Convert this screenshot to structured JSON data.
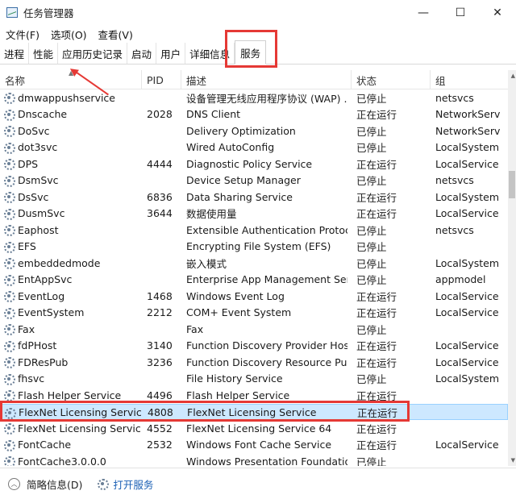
{
  "window": {
    "title": "任务管理器",
    "controls": {
      "minimize": "—",
      "maximize": "☐",
      "close": "✕"
    }
  },
  "menu": [
    {
      "label": "文件(F)"
    },
    {
      "label": "选项(O)"
    },
    {
      "label": "查看(V)"
    }
  ],
  "tabs": [
    {
      "label": "进程"
    },
    {
      "label": "性能"
    },
    {
      "label": "应用历史记录"
    },
    {
      "label": "启动"
    },
    {
      "label": "用户"
    },
    {
      "label": "详细信息"
    },
    {
      "label": "服务",
      "active": true
    }
  ],
  "columns": {
    "name": "名称",
    "pid": "PID",
    "desc": "描述",
    "status": "状态",
    "group": "组"
  },
  "rows": [
    {
      "name": "dmwappushservice",
      "pid": "",
      "desc": "设备管理无线应用程序协议 (WAP) ...",
      "status": "已停止",
      "group": "netsvcs"
    },
    {
      "name": "Dnscache",
      "pid": "2028",
      "desc": "DNS Client",
      "status": "正在运行",
      "group": "NetworkServ..."
    },
    {
      "name": "DoSvc",
      "pid": "",
      "desc": "Delivery Optimization",
      "status": "已停止",
      "group": "NetworkServ..."
    },
    {
      "name": "dot3svc",
      "pid": "",
      "desc": "Wired AutoConfig",
      "status": "已停止",
      "group": "LocalSystem..."
    },
    {
      "name": "DPS",
      "pid": "4444",
      "desc": "Diagnostic Policy Service",
      "status": "正在运行",
      "group": "LocalService..."
    },
    {
      "name": "DsmSvc",
      "pid": "",
      "desc": "Device Setup Manager",
      "status": "已停止",
      "group": "netsvcs"
    },
    {
      "name": "DsSvc",
      "pid": "6836",
      "desc": "Data Sharing Service",
      "status": "正在运行",
      "group": "LocalSystem..."
    },
    {
      "name": "DusmSvc",
      "pid": "3644",
      "desc": "数据使用量",
      "status": "正在运行",
      "group": "LocalService..."
    },
    {
      "name": "Eaphost",
      "pid": "",
      "desc": "Extensible Authentication Protocol",
      "status": "已停止",
      "group": "netsvcs"
    },
    {
      "name": "EFS",
      "pid": "",
      "desc": "Encrypting File System (EFS)",
      "status": "已停止",
      "group": ""
    },
    {
      "name": "embeddedmode",
      "pid": "",
      "desc": "嵌入模式",
      "status": "已停止",
      "group": "LocalSystem..."
    },
    {
      "name": "EntAppSvc",
      "pid": "",
      "desc": "Enterprise App Management Ser...",
      "status": "已停止",
      "group": "appmodel"
    },
    {
      "name": "EventLog",
      "pid": "1468",
      "desc": "Windows Event Log",
      "status": "正在运行",
      "group": "LocalService..."
    },
    {
      "name": "EventSystem",
      "pid": "2212",
      "desc": "COM+ Event System",
      "status": "正在运行",
      "group": "LocalService"
    },
    {
      "name": "Fax",
      "pid": "",
      "desc": "Fax",
      "status": "已停止",
      "group": ""
    },
    {
      "name": "fdPHost",
      "pid": "3140",
      "desc": "Function Discovery Provider Host",
      "status": "正在运行",
      "group": "LocalService"
    },
    {
      "name": "FDResPub",
      "pid": "3236",
      "desc": "Function Discovery Resource Pub...",
      "status": "正在运行",
      "group": "LocalService..."
    },
    {
      "name": "fhsvc",
      "pid": "",
      "desc": "File History Service",
      "status": "已停止",
      "group": "LocalSystem..."
    },
    {
      "name": "Flash Helper Service",
      "pid": "4496",
      "desc": "Flash Helper Service",
      "status": "正在运行",
      "group": ""
    },
    {
      "name": "FlexNet Licensing Service",
      "pid": "4808",
      "desc": "FlexNet Licensing Service",
      "status": "正在运行",
      "group": "",
      "selected": true
    },
    {
      "name": "FlexNet Licensing Service...",
      "pid": "4552",
      "desc": "FlexNet Licensing Service 64",
      "status": "正在运行",
      "group": ""
    },
    {
      "name": "FontCache",
      "pid": "2532",
      "desc": "Windows Font Cache Service",
      "status": "正在运行",
      "group": "LocalService"
    },
    {
      "name": "FontCache3.0.0.0",
      "pid": "",
      "desc": "Windows Presentation Foundatio...",
      "status": "已停止",
      "group": ""
    }
  ],
  "footer": {
    "details_label": "简略信息(D)",
    "open_services_label": "打开服务"
  },
  "colors": {
    "highlight_red": "#e53935",
    "selection_bg": "#cde8ff",
    "link_blue": "#1a5fb4"
  }
}
